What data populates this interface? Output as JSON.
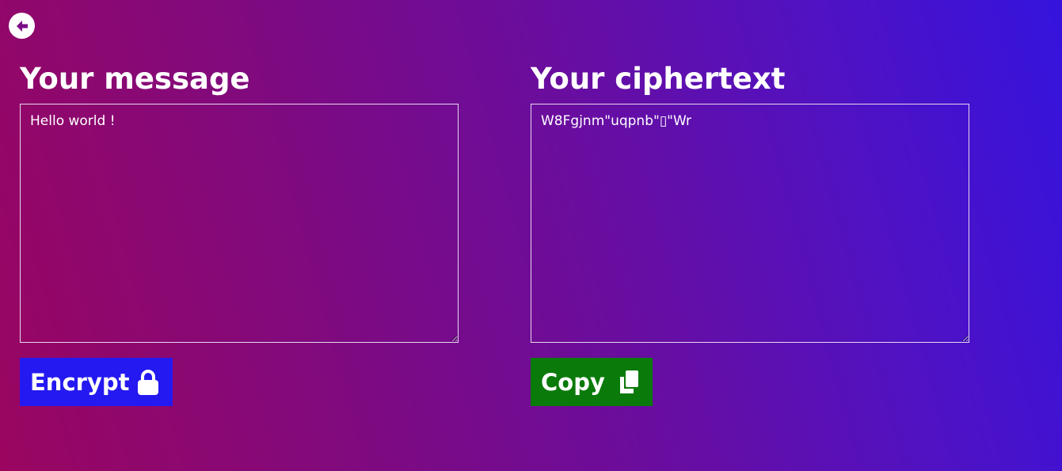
{
  "nav": {
    "back_icon": "arrow-left-circle-icon"
  },
  "message_panel": {
    "title": "Your message",
    "value": "Hello world !",
    "encrypt_label": "Encrypt",
    "encrypt_icon": "lock-icon"
  },
  "cipher_panel": {
    "title": "Your ciphertext",
    "value": "W8Fgjnm\"uqpnb\"▯\"Wr",
    "copy_label": "Copy",
    "copy_icon": "copy-icon"
  },
  "colors": {
    "encrypt_button": "#2419f0",
    "copy_button": "#0a7a0a",
    "gradient_start": "#9a0560",
    "gradient_end": "#3513dd"
  }
}
